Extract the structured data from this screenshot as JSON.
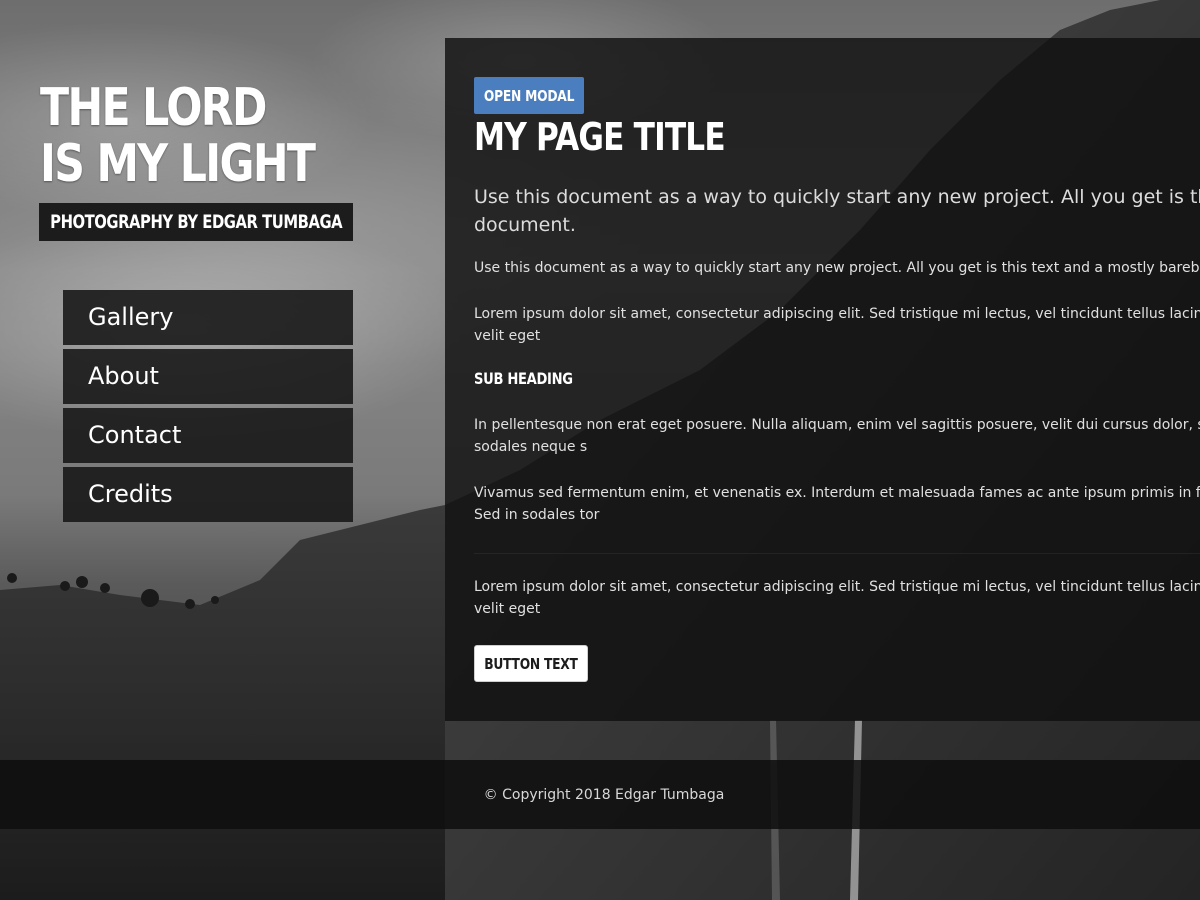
{
  "site": {
    "title_line1": "THE LORD",
    "title_line2": "IS MY LIGHT",
    "subtitle": "PHOTOGRAPHY BY EDGAR TUMBAGA"
  },
  "nav": {
    "items": [
      {
        "label": "Gallery"
      },
      {
        "label": "About"
      },
      {
        "label": "Contact"
      },
      {
        "label": "Credits"
      }
    ]
  },
  "main": {
    "open_modal_label": "OPEN MODAL",
    "page_title": "MY PAGE TITLE",
    "lead_line1": "Use this document as a way to quickly start any new project. All you get is this",
    "lead_line2": "document.",
    "para1": "Use this document as a way to quickly start any new project. All you get is this text and a mostly barebo",
    "para2_line1": "Lorem ipsum dolor sit amet, consectetur adipiscing elit. Sed tristique mi lectus, vel tincidunt tellus lacin",
    "para2_line2": "velit eget",
    "sub_heading": "SUB HEADING",
    "para3_line1": "In pellentesque non erat eget posuere. Nulla aliquam, enim vel sagittis posuere, velit dui cursus dolor, s",
    "para3_line2": "sodales neque s",
    "para4_line1": "Vivamus sed fermentum enim, et venenatis ex. Interdum et malesuada fames ac ante ipsum primis in fau",
    "para4_line2": "Sed in sodales tor",
    "para5_line1": "Lorem ipsum dolor sit amet, consectetur adipiscing elit. Sed tristique mi lectus, vel tincidunt tellus lacin",
    "para5_line2": "velit eget",
    "button_text": "BUTTON TEXT"
  },
  "footer": {
    "copyright_symbol": "©",
    "copyright_text": "Copyright 2018 Edgar Tumbaga"
  },
  "colors": {
    "accent": "#4a7ebf",
    "panel_bg": "#101010",
    "nav_bg": "#161616"
  }
}
